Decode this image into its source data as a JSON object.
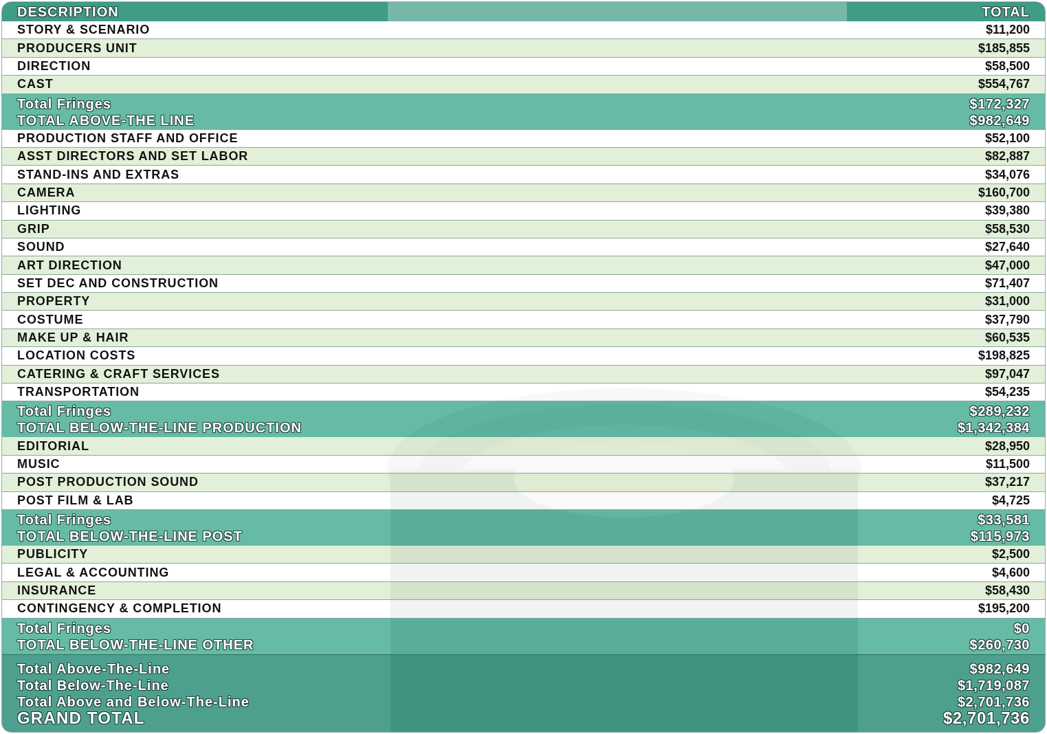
{
  "header": {
    "description": "DESCRIPTION",
    "total": "TOTAL"
  },
  "rows": [
    {
      "kind": "item",
      "label": "STORY & SCENARIO",
      "amount": "$11,200"
    },
    {
      "kind": "item",
      "label": "PRODUCERS UNIT",
      "amount": "$185,855"
    },
    {
      "kind": "item",
      "label": "DIRECTION",
      "amount": "$58,500"
    },
    {
      "kind": "item",
      "label": "CAST",
      "amount": "$554,767"
    },
    {
      "kind": "subtotal",
      "lines": [
        {
          "label": "Total Fringes",
          "amount": "$172,327"
        },
        {
          "label": "TOTAL ABOVE-THE LINE",
          "amount": "$982,649"
        }
      ]
    },
    {
      "kind": "item",
      "label": "PRODUCTION STAFF AND OFFICE",
      "amount": "$52,100"
    },
    {
      "kind": "item",
      "label": "ASST DIRECTORS AND SET LABOR",
      "amount": "$82,887"
    },
    {
      "kind": "item",
      "label": "STAND-INS AND EXTRAS",
      "amount": "$34,076"
    },
    {
      "kind": "item",
      "label": "CAMERA",
      "amount": "$160,700"
    },
    {
      "kind": "item",
      "label": "LIGHTING",
      "amount": "$39,380"
    },
    {
      "kind": "item",
      "label": "GRIP",
      "amount": "$58,530"
    },
    {
      "kind": "item",
      "label": "SOUND",
      "amount": "$27,640"
    },
    {
      "kind": "item",
      "label": "ART DIRECTION",
      "amount": "$47,000"
    },
    {
      "kind": "item",
      "label": "SET DEC AND CONSTRUCTION",
      "amount": "$71,407"
    },
    {
      "kind": "item",
      "label": "PROPERTY",
      "amount": "$31,000"
    },
    {
      "kind": "item",
      "label": "COSTUME",
      "amount": "$37,790"
    },
    {
      "kind": "item",
      "label": "MAKE UP & HAIR",
      "amount": "$60,535"
    },
    {
      "kind": "item",
      "label": "LOCATION COSTS",
      "amount": "$198,825"
    },
    {
      "kind": "item",
      "label": "CATERING & CRAFT SERVICES",
      "amount": "$97,047"
    },
    {
      "kind": "item",
      "label": "TRANSPORTATION",
      "amount": "$54,235"
    },
    {
      "kind": "subtotal",
      "lines": [
        {
          "label": "Total Fringes",
          "amount": "$289,232"
        },
        {
          "label": "TOTAL BELOW-THE-LINE PRODUCTION",
          "amount": "$1,342,384"
        }
      ]
    },
    {
      "kind": "item",
      "label": "EDITORIAL",
      "amount": "$28,950"
    },
    {
      "kind": "item",
      "label": "MUSIC",
      "amount": "$11,500"
    },
    {
      "kind": "item",
      "label": "POST PRODUCTION SOUND",
      "amount": "$37,217"
    },
    {
      "kind": "item",
      "label": "POST FILM & LAB",
      "amount": "$4,725"
    },
    {
      "kind": "subtotal",
      "lines": [
        {
          "label": "Total Fringes",
          "amount": "$33,581"
        },
        {
          "label": "TOTAL BELOW-THE-LINE POST",
          "amount": "$115,973"
        }
      ]
    },
    {
      "kind": "item",
      "label": "PUBLICITY",
      "amount": "$2,500"
    },
    {
      "kind": "item",
      "label": "LEGAL & ACCOUNTING",
      "amount": "$4,600"
    },
    {
      "kind": "item",
      "label": "INSURANCE",
      "amount": "$58,430"
    },
    {
      "kind": "item",
      "label": "CONTINGENCY & COMPLETION",
      "amount": "$195,200"
    },
    {
      "kind": "subtotal",
      "lines": [
        {
          "label": "Total Fringes",
          "amount": "$0"
        },
        {
          "label": "TOTAL BELOW-THE-LINE OTHER",
          "amount": "$260,730"
        }
      ]
    },
    {
      "kind": "summary",
      "lines": [
        {
          "label": "Total Above-The-Line",
          "amount": "$982,649"
        },
        {
          "label": "Total Below-The-Line",
          "amount": "$1,719,087"
        },
        {
          "label": "Total Above and Below-The-Line",
          "amount": "$2,701,736"
        },
        {
          "label": "GRAND TOTAL",
          "amount": "$2,701,736"
        }
      ]
    }
  ]
}
